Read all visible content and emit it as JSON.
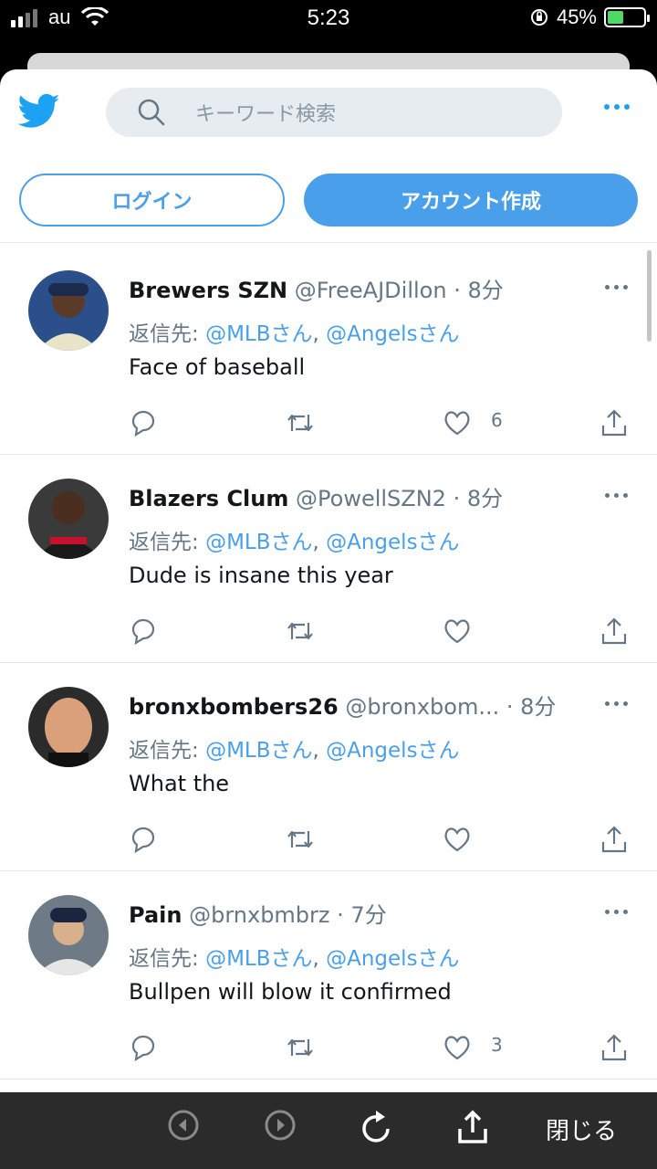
{
  "status": {
    "carrier": "au",
    "time": "5:23",
    "battery_pct": "45%",
    "battery_level": 0.45
  },
  "header": {
    "search_placeholder": "キーワード検索",
    "login_label": "ログイン",
    "signup_label": "アカウント作成"
  },
  "tweets": [
    {
      "name": "Brewers SZN",
      "handle": "@FreeAJDillon",
      "time": "8分",
      "reply_prefix": "返信先:",
      "mention1": "@MLBさん",
      "sep": ",",
      "mention2": "@Angelsさん",
      "text": "Face of baseball",
      "likes": "6"
    },
    {
      "name": "Blazers Clum",
      "handle": "@PowellSZN2",
      "time": "8分",
      "reply_prefix": "返信先:",
      "mention1": "@MLBさん",
      "sep": ",",
      "mention2": "@Angelsさん",
      "text": "Dude is insane this year",
      "likes": ""
    },
    {
      "name": "bronxbombers26",
      "handle": "@bronxbom...",
      "time": "8分",
      "reply_prefix": "返信先:",
      "mention1": "@MLBさん",
      "sep": ",",
      "mention2": "@Angelsさん",
      "text": "What the",
      "likes": ""
    },
    {
      "name": "Pain",
      "handle": "@brnxbmbrz",
      "time": "7分",
      "reply_prefix": "返信先:",
      "mention1": "@MLBさん",
      "sep": ",",
      "mention2": "@Angelsさん",
      "text": "Bullpen will blow it confirmed",
      "likes": "3"
    }
  ],
  "toolbar": {
    "close_label": "閉じる"
  },
  "colors": {
    "accent": "#4a9fea",
    "twitter_blue": "#1da1f2",
    "muted": "#657786"
  }
}
